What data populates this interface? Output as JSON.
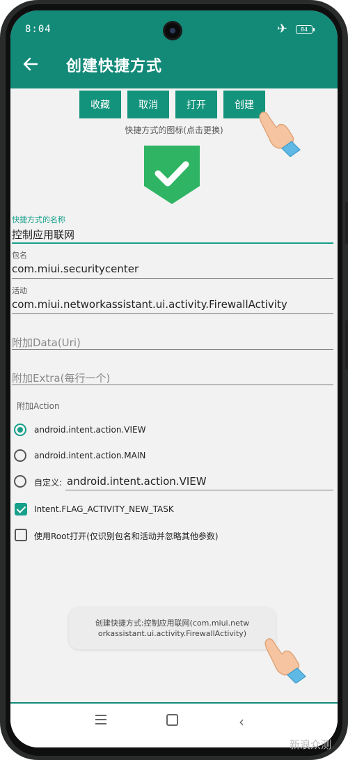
{
  "status_bar": {
    "time": "8:04",
    "battery": "84"
  },
  "app_bar": {
    "title": "创建快捷方式"
  },
  "actions": {
    "favorite": "收藏",
    "cancel": "取消",
    "open": "打开",
    "create": "创建"
  },
  "icon_section": {
    "caption": "快捷方式的图标(点击更换)",
    "icon": "green-shield-check-icon"
  },
  "fields": {
    "name": {
      "label": "快捷方式的名称",
      "value": "控制应用联网"
    },
    "package": {
      "label": "包名",
      "value": "com.miui.securitycenter"
    },
    "activity": {
      "label": "活动",
      "value": "com.miui.networkassistant.ui.activity.FirewallActivity"
    },
    "data_placeholder": "附加Data(Uri)",
    "extra_placeholder": "附加Extra(每行一个)"
  },
  "action_section": {
    "label": "附加Action",
    "options": [
      "android.intent.action.VIEW",
      "android.intent.action.MAIN"
    ],
    "selected": 0,
    "custom_label": "自定义:",
    "custom_value": "android.intent.action.VIEW"
  },
  "flags": {
    "new_task": {
      "label": "Intent.FLAG_ACTIVITY_NEW_TASK",
      "checked": true
    },
    "root_open": {
      "label": "使用Root打开(仅识别包名和活动并忽略其他参数)",
      "checked": false
    }
  },
  "toast": {
    "line1": "创建快捷方式:控制应用联网(com.miui.netw",
    "line2": "orkassistant.ui.activity.FirewallActivity)"
  },
  "watermark": "新浪众测",
  "colors": {
    "accent": "#17a08a",
    "app_bar": "#138a78",
    "button": "#14937c"
  }
}
